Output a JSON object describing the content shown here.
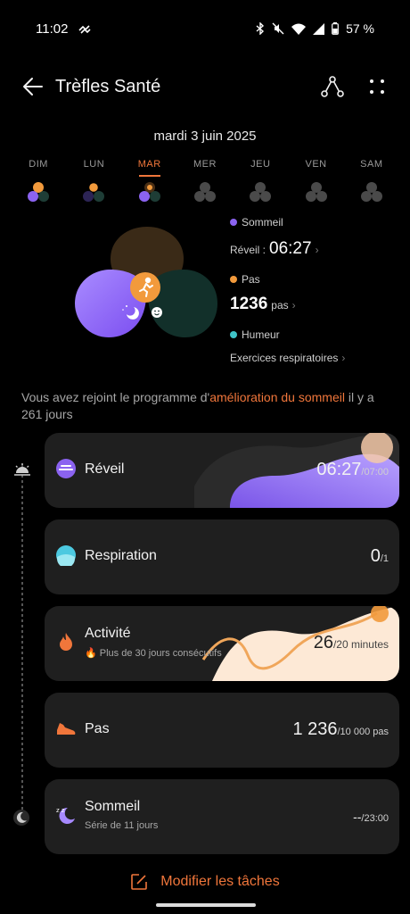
{
  "status": {
    "time": "11:02",
    "battery": "57 %"
  },
  "header": {
    "title": "Trèfles Santé"
  },
  "date": "mardi 3 juin 2025",
  "week": [
    {
      "label": "DIM",
      "active": false,
      "colored": true
    },
    {
      "label": "LUN",
      "active": false,
      "colored": true
    },
    {
      "label": "MAR",
      "active": true,
      "colored": true
    },
    {
      "label": "MER",
      "active": false,
      "colored": false
    },
    {
      "label": "JEU",
      "active": false,
      "colored": false
    },
    {
      "label": "VEN",
      "active": false,
      "colored": false
    },
    {
      "label": "SAM",
      "active": false,
      "colored": false
    }
  ],
  "metrics": {
    "sleep_label": "Sommeil",
    "wake_prefix": "Réveil :",
    "wake_value": "06:27",
    "steps_label": "Pas",
    "steps_value": "1236",
    "steps_unit": "pas",
    "mood_label": "Humeur",
    "breathing_link": "Exercices respiratoires"
  },
  "program": {
    "prefix": "Vous avez rejoint le programme d'",
    "highlight": "amélioration du sommeil",
    "suffix": " il y a 261 jours"
  },
  "cards": {
    "wake": {
      "title": "Réveil",
      "value": "06:27",
      "target": "/07:00"
    },
    "breathing": {
      "title": "Respiration",
      "value": "0",
      "target": "/1"
    },
    "activity": {
      "title": "Activité",
      "subtitle": "🔥 Plus de 30 jours consécutifs",
      "value": "26",
      "target": "/20 minutes"
    },
    "steps": {
      "title": "Pas",
      "value": "1 236",
      "target": "/10 000 pas"
    },
    "sleep": {
      "title": "Sommeil",
      "subtitle": "Série de 11 jours",
      "value": "--",
      "target": "/23:00"
    }
  },
  "footer": {
    "edit_label": "Modifier les tâches"
  },
  "colors": {
    "accent": "#f0763b",
    "sleep": "#8b63f0",
    "steps": "#f29a3c",
    "mood": "#3fc4c8"
  }
}
